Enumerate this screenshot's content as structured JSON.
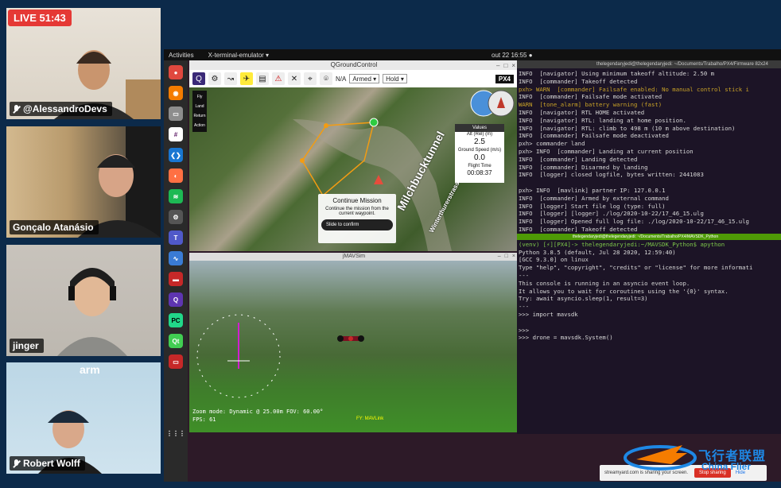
{
  "stream": {
    "live_badge": "LIVE 51:43"
  },
  "participants": [
    {
      "name": "@AlessandroDevs",
      "muted": true
    },
    {
      "name": "Gonçalo Atanásio",
      "muted": false
    },
    {
      "name": "jinger",
      "muted": false
    },
    {
      "name": "Robert Wolff",
      "muted": true
    }
  ],
  "desktop": {
    "topbar": {
      "activities": "Activities",
      "app": "X-terminal-emulator ▾",
      "clock": "out 22  16:55  ●"
    },
    "dock": [
      "chrome",
      "firefox",
      "files",
      "slack",
      "vscode",
      "zoom",
      "spotify",
      "settings",
      "teams",
      "monitor",
      "terminal",
      "qgc",
      "pycharm",
      "qt",
      "screen",
      "apps"
    ]
  },
  "qgc": {
    "title": "QGroundControl",
    "toolbar": {
      "armed": "Armed ▾",
      "mode": "Hold ▾",
      "gps": "N/A",
      "brand": "PX4"
    },
    "left_tools": [
      "Fly",
      "Land",
      "Return",
      "Action"
    ],
    "values": {
      "header": "Values",
      "alt_label": "Alt (Rel) (m)",
      "alt_value": "2.5",
      "speed_label": "Ground Speed (m/s)",
      "speed_value": "0.0",
      "time_label": "Flight Time",
      "time_value": "00:08:37"
    },
    "continue": {
      "title": "Continue Mission",
      "text": "Continue the mission from the current waypoint.",
      "slide": "Slide to confirm"
    },
    "street1": "Milchbucktunnel",
    "street2": "Winterthurerstrasse"
  },
  "jmavsim": {
    "title": "jMAVSim",
    "zoom_line": "Zoom mode: Dynamic @ 25.00m   FOV: 60.00°",
    "fps_line": "FPS:  61",
    "hud_mode": "FY: MAVLink"
  },
  "terminal": {
    "title": "thelegendaryjedi@thelegendaryjedi: ~/Documents/Trabalho/PX4/Firmware 82x24",
    "lines_top": [
      {
        "t": "INFO  [navigator] Using minimum takeoff altitude: 2.50 m",
        "c": ""
      },
      {
        "t": "INFO  [commander] Takeoff detected",
        "c": ""
      },
      {
        "t": "pxh> WARN  [commander] Failsafe enabled: No manual control stick i",
        "c": "warn"
      },
      {
        "t": "INFO  [commander] Failsafe mode activated",
        "c": ""
      },
      {
        "t": "WARN  [tone_alarm] battery warning (fast)",
        "c": "warn"
      },
      {
        "t": "INFO  [navigator] RTL HOME activated",
        "c": ""
      },
      {
        "t": "INFO  [navigator] RTL: landing at home position.",
        "c": ""
      },
      {
        "t": "INFO  [navigator] RTL: climb to 498 m (10 m above destination)",
        "c": ""
      },
      {
        "t": "INFO  [commander] Failsafe mode deactivated",
        "c": ""
      },
      {
        "t": "pxh> commander land",
        "c": ""
      },
      {
        "t": "pxh> INFO  [commander] Landing at current position",
        "c": ""
      },
      {
        "t": "INFO  [commander] Landing detected",
        "c": ""
      },
      {
        "t": "INFO  [commander] Disarmed by landing",
        "c": ""
      },
      {
        "t": "INFO  [logger] closed logfile, bytes written: 2441083",
        "c": ""
      },
      {
        "t": "",
        "c": ""
      },
      {
        "t": "pxh> INFO  [mavlink] partner IP: 127.0.0.1",
        "c": ""
      },
      {
        "t": "INFO  [commander] Armed by external command",
        "c": ""
      },
      {
        "t": "INFO  [logger] Start file log (type: full)",
        "c": ""
      },
      {
        "t": "INFO  [logger] [logger] ./log/2020-10-22/17_46_15.ulg",
        "c": ""
      },
      {
        "t": "INFO  [logger] Opened full log file: ./log/2020-10-22/17_46_15.ulg",
        "c": ""
      },
      {
        "t": "INFO  [commander] Takeoff detected",
        "c": ""
      }
    ],
    "split_title": "thelegendaryjedi@thelegendaryjedi: ~/Documents/Trabalho/PX4/MAVSDK_Python",
    "lines_bottom": [
      {
        "t": "(venv) [⚡][PX4]-> thelegendaryjedi:~/MAVSDK_Python$ apython",
        "c": "green"
      },
      {
        "t": "Python 3.8.5 (default, Jul 28 2020, 12:59:40)",
        "c": ""
      },
      {
        "t": "[GCC 9.3.0] on linux",
        "c": ""
      },
      {
        "t": "Type \"help\", \"copyright\", \"credits\" or \"license\" for more informati",
        "c": ""
      },
      {
        "t": "---",
        "c": ""
      },
      {
        "t": "This console is running in an asyncio event loop.",
        "c": ""
      },
      {
        "t": "It allows you to wait for coroutines using the '{0}' syntax.",
        "c": ""
      },
      {
        "t": "Try: await asyncio.sleep(1, result=3)",
        "c": ""
      },
      {
        "t": "---",
        "c": ""
      },
      {
        "t": ">>> import mavsdk",
        "c": ""
      },
      {
        "t": "",
        "c": ""
      },
      {
        "t": ">>>",
        "c": ""
      },
      {
        "t": ">>> drone = mavsdk.System()",
        "c": ""
      }
    ]
  },
  "share_bar": {
    "text": "streamyard.com is sharing your screen.",
    "stop": "Stop sharing",
    "hide": "Hide"
  },
  "watermark": {
    "cn": "飞行者联盟",
    "en": "China Flier"
  }
}
